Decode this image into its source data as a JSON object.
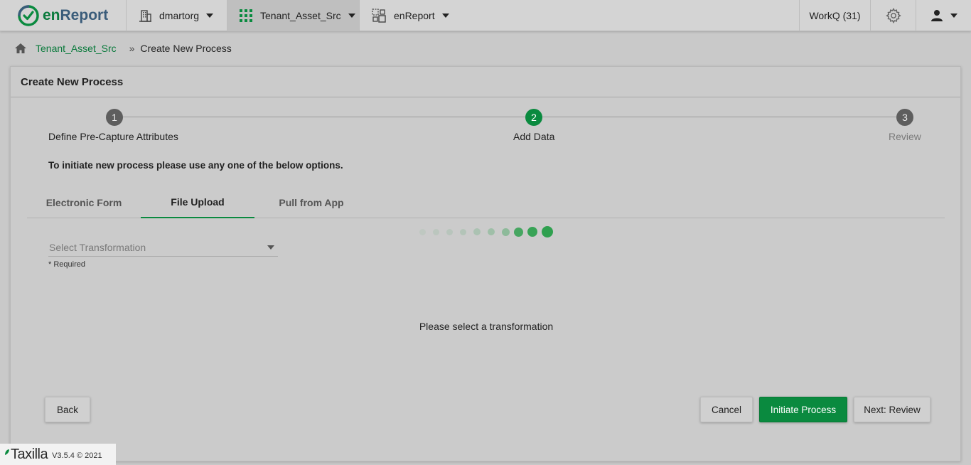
{
  "app": {
    "logo_en": "en",
    "logo_report": "Report",
    "brand_color": "#0a8a3f"
  },
  "topnav": {
    "org": "dmartorg",
    "workspace": "Tenant_Asset_Src",
    "app": "enReport",
    "workq": "WorkQ (31)"
  },
  "breadcrumb": {
    "items": [
      "Tenant_Asset_Src",
      "Create New Process"
    ],
    "separator": "»"
  },
  "card": {
    "title": "Create New Process"
  },
  "stepper": {
    "steps": [
      {
        "number": "1",
        "label": "Define Pre-Capture Attributes",
        "state": "complete"
      },
      {
        "number": "2",
        "label": "Add Data",
        "state": "active"
      },
      {
        "number": "3",
        "label": "Review",
        "state": "pending"
      }
    ]
  },
  "instruction": "To initiate new process please use any one of the below options.",
  "tabs": [
    {
      "label": "Electronic Form",
      "active": false
    },
    {
      "label": "File Upload",
      "active": true
    },
    {
      "label": "Pull from App",
      "active": false
    }
  ],
  "transformation": {
    "placeholder": "Select Transformation",
    "required_note": "* Required"
  },
  "empty_message": "Please select a transformation",
  "buttons": {
    "back": "Back",
    "cancel": "Cancel",
    "initiate": "Initiate Process",
    "next": "Next: Review"
  },
  "footer": {
    "logo": "Taxilla",
    "version": "V3.5.4 © 2021"
  }
}
